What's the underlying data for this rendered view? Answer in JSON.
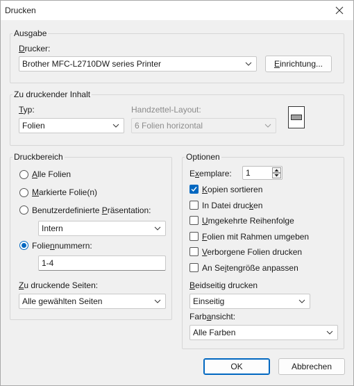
{
  "window": {
    "title": "Drucken"
  },
  "ausgabe": {
    "group_label": "Ausgabe",
    "drucker_label_pre": "",
    "drucker_label_u": "D",
    "drucker_label_post": "rucker:",
    "printer_value": "Brother MFC-L2710DW series Printer",
    "setup_u": "E",
    "setup_rest": "inrichtung..."
  },
  "inhalt": {
    "group_label": "Zu druckender Inhalt",
    "typ_u": "T",
    "typ_rest": "yp:",
    "typ_value": "Folien",
    "handout_label": "Handzettel-Layout:",
    "handout_value": "6 Folien horizontal"
  },
  "druckbereich": {
    "group_label": "Druckbereich",
    "alle_u": "A",
    "alle_rest": "lle Folien",
    "markierte_u": "M",
    "markierte_rest": "arkierte Folie(n)",
    "benutzer_pre": "Benutzerdefinierte ",
    "benutzer_u": "P",
    "benutzer_post": "räsentation:",
    "custom_value": "Intern",
    "nummern_pre": "Folie",
    "nummern_u": "n",
    "nummern_post": "nummern:",
    "nummern_value": "1-4",
    "seiten_u": "Z",
    "seiten_rest": "u druckende Seiten:",
    "seiten_value": "Alle gewählten Seiten"
  },
  "optionen": {
    "group_label": "Optionen",
    "exemplare_pre": "E",
    "exemplare_u": "x",
    "exemplare_post": "emplare:",
    "exemplare_value": "1",
    "sortieren_u": "K",
    "sortieren_rest": "opien sortieren",
    "datei_pre": "In Datei druc",
    "datei_u": "k",
    "datei_post": "en",
    "umgekehrt_u": "U",
    "umgekehrt_rest": "mgekehrte Reihenfolge",
    "rahmen_u": "F",
    "rahmen_rest": "olien mit Rahmen umgeben",
    "verborgen_u": "V",
    "verborgen_rest": "erborgene Folien drucken",
    "anpassen_pre": "An Se",
    "anpassen_u": "i",
    "anpassen_post": "tengröße anpassen",
    "beidseitig_u": "B",
    "beidseitig_rest": "eidseitig drucken",
    "beidseitig_value": "Einseitig",
    "farb_pre": "Farb",
    "farb_u": "a",
    "farb_post": "nsicht:",
    "farb_value": "Alle Farben"
  },
  "buttons": {
    "ok": "OK",
    "cancel": "Abbrechen"
  },
  "colors": {
    "accent": "#0067c0",
    "background": "#f0f0f0"
  }
}
